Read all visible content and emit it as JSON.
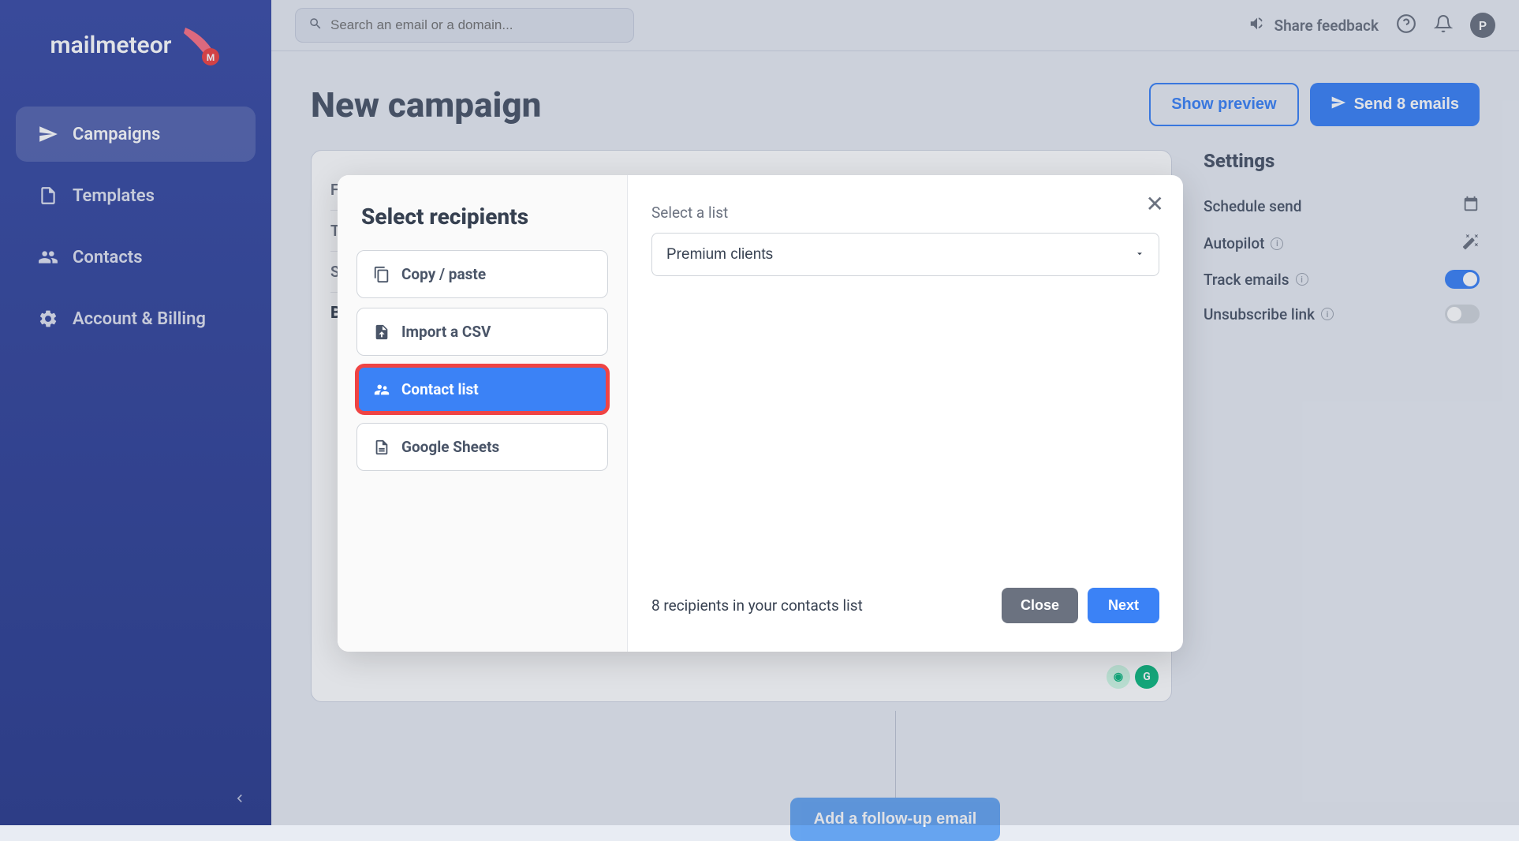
{
  "brand": "mailmeteor",
  "sidebar": {
    "items": [
      {
        "label": "Campaigns"
      },
      {
        "label": "Templates"
      },
      {
        "label": "Contacts"
      },
      {
        "label": "Account & Billing"
      }
    ]
  },
  "topbar": {
    "search_placeholder": "Search an email or a domain...",
    "feedback": "Share feedback",
    "avatar_initial": "P"
  },
  "page": {
    "title": "New campaign",
    "preview_btn": "Show preview",
    "send_btn": "Send 8 emails",
    "fields": {
      "from": "From",
      "to": "To",
      "subject": "Subject",
      "body": "Body"
    },
    "followup_btn": "Add a follow-up email"
  },
  "settings": {
    "title": "Settings",
    "schedule": "Schedule send",
    "autopilot": "Autopilot",
    "track": "Track emails",
    "unsubscribe": "Unsubscribe link"
  },
  "modal": {
    "title": "Select recipients",
    "options": [
      {
        "label": "Copy / paste"
      },
      {
        "label": "Import a CSV"
      },
      {
        "label": "Contact list"
      },
      {
        "label": "Google Sheets"
      }
    ],
    "select_label": "Select a list",
    "selected_list": "Premium clients",
    "recipients_text": "8 recipients in your contacts list",
    "close_btn": "Close",
    "next_btn": "Next"
  }
}
